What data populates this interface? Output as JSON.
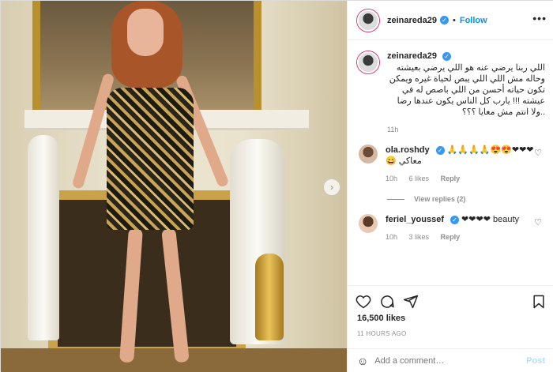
{
  "header": {
    "username": "zeinareda29",
    "verified_icon": "verified-icon",
    "separator": "•",
    "follow_label": "Follow",
    "more_icon": "more-options-icon"
  },
  "caption": {
    "username": "zeinareda29",
    "text": "اللي ربنا يرضي عنه هو اللي يرضي بعيشته وحاله مش اللي اللي يبص لحياة غيره ويمكن تكون حياته أحسن من اللي باصص له في عيشته !!! يارب كل الناس يكون عندها رضا ..ولا انتم مش معايا ؟؟؟",
    "age": "11h"
  },
  "comments": [
    {
      "username": "ola.roshdy",
      "text": "❤❤❤😍😍🙏🙏🙏🙏 معاكي 😄",
      "age": "10h",
      "likes": "6 likes",
      "reply_label": "Reply",
      "view_replies": "View replies (2)"
    },
    {
      "username": "feriel_youssef",
      "text": "❤❤❤❤ beauty",
      "age": "10h",
      "likes": "3 likes",
      "reply_label": "Reply"
    }
  ],
  "actions": {
    "like_icon": "heart-icon",
    "comment_icon": "comment-icon",
    "share_icon": "share-icon",
    "save_icon": "bookmark-icon"
  },
  "likes_count": "16,500 likes",
  "posted_ago": "11 HOURS AGO",
  "add_comment": {
    "placeholder": "Add a comment…",
    "post_label": "Post",
    "emoji_icon": "emoji-icon"
  },
  "colors": {
    "accent": "#0095f6",
    "verified": "#3897f0",
    "muted": "#8e8e8e",
    "post_disabled": "#b2dffc"
  }
}
